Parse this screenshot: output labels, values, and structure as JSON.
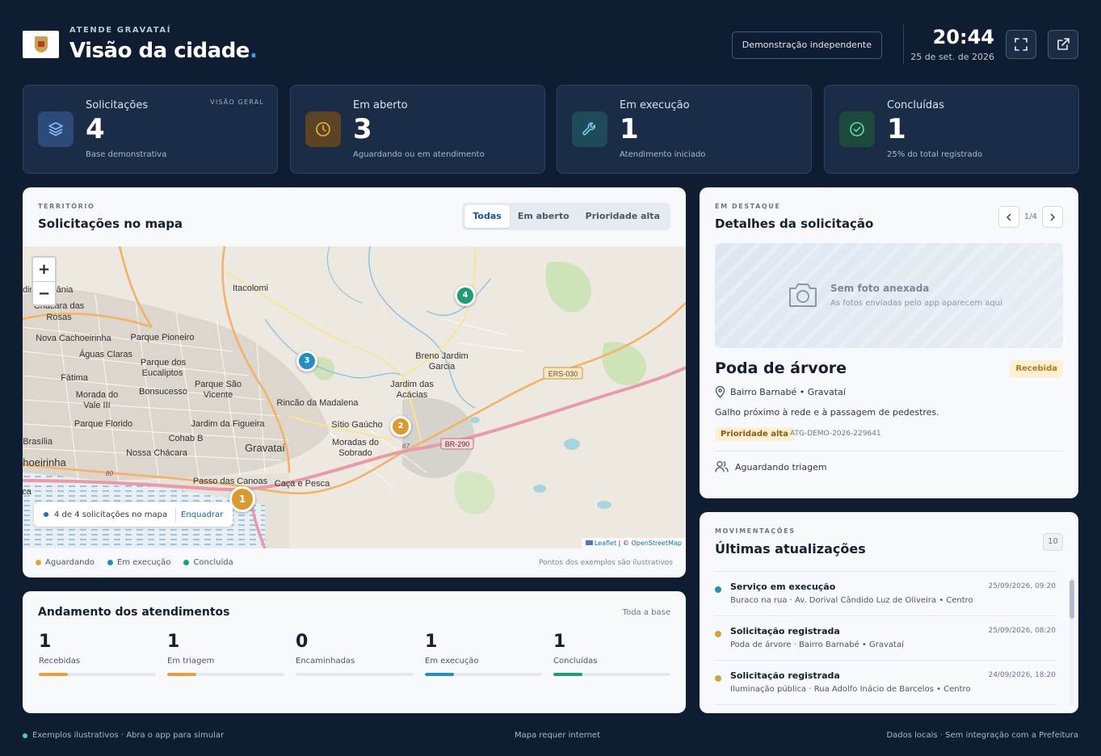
{
  "header": {
    "org": "ATENDE GRAVATAÍ",
    "title": "Visão da cidade",
    "title_dot": ".",
    "demo_button": "Demonstração independente",
    "time": "20:44",
    "date": "25 de set. de 2026"
  },
  "kpis": [
    {
      "label": "Solicitações",
      "value": "4",
      "note": "Base demonstrativa",
      "badge": "VISÃO GERAL",
      "icon": "layers-icon",
      "color": "#6ea8ff"
    },
    {
      "label": "Em aberto",
      "value": "3",
      "note": "Aguardando ou em atendimento",
      "icon": "clock-icon",
      "color": "#e3a33c"
    },
    {
      "label": "Em execução",
      "value": "1",
      "note": "Atendimento iniciado",
      "icon": "wrench-icon",
      "color": "#4fb6d8"
    },
    {
      "label": "Concluídas",
      "value": "1",
      "note": "25% do total registrado",
      "icon": "check-circle-icon",
      "color": "#4fd1a5"
    }
  ],
  "map_panel": {
    "eyebrow": "TERRITÓRIO",
    "title": "Solicitações no mapa",
    "filters": [
      "Todas",
      "Em aberto",
      "Prioridade alta"
    ],
    "active_filter": "Todas",
    "zoom_in": "+",
    "zoom_out": "−",
    "status_text": "4 de 4 solicitações no mapa",
    "fit_link": "Enquadrar",
    "attribution_leaflet": "Leaflet",
    "attribution_sep": "| ©",
    "attribution_osm": "OpenStreetMap",
    "markers": [
      "1",
      "2",
      "3",
      "4"
    ],
    "place_labels": [
      "Itacolomi",
      "Parque Pioneiro",
      "Nova Cachoeirinha",
      "Águas Claras",
      "Parque dos",
      "Eucaliptos",
      "Fátima",
      "Bonsucesso",
      "Parque São",
      "Vicente",
      "Morada do",
      "Vale III",
      "Parque Florido",
      "Jardim da Figueira",
      "Cohab B",
      "Gravataí",
      "Nossa Chácara",
      "Rincão da Madalena",
      "Sítio Gaúcho",
      "Moradas do",
      "Sobrado",
      "Breno Jardim",
      "Garcia",
      "Jardim das",
      "Acácias",
      "Passo das Canoas",
      "Caça e Pesca",
      "Chácara das",
      "Rosas",
      "rdim",
      "ânia",
      "e Brasília",
      "hoeirinha",
      "ca"
    ],
    "road_labels": [
      "ERS-030",
      "BR-290",
      "67",
      "80"
    ],
    "legend": [
      {
        "label": "Aguardando",
        "color": "#e3a33c"
      },
      {
        "label": "Em execução",
        "color": "#1f8fc4"
      },
      {
        "label": "Concluída",
        "color": "#1f9e74"
      }
    ],
    "note": "Pontos dos exemplos são ilustrativos"
  },
  "progress": {
    "title": "Andamento dos atendimentos",
    "scope": "Toda a base",
    "items": [
      {
        "value": "1",
        "label": "Recebidas",
        "fraction": 0.25,
        "color": "#e3a33c"
      },
      {
        "value": "1",
        "label": "Em triagem",
        "fraction": 0.25,
        "color": "#e3a33c"
      },
      {
        "value": "0",
        "label": "Encaminhadas",
        "fraction": 0,
        "color": "#8a97a8"
      },
      {
        "value": "1",
        "label": "Em execução",
        "fraction": 0.25,
        "color": "#1f8fc4"
      },
      {
        "value": "1",
        "label": "Concluídas",
        "fraction": 0.25,
        "color": "#1f9e74"
      }
    ]
  },
  "detail": {
    "eyebrow": "EM DESTAQUE",
    "title": "Detalhes da solicitação",
    "pager": "1/4",
    "photo_title": "Sem foto anexada",
    "photo_sub": "As fotos enviadas pelo app aparecem aqui",
    "request_title": "Poda de árvore",
    "status": "Recebida",
    "location": "Bairro Barnabé • Gravataí",
    "description": "Galho próximo à rede e à passagem de pedestres.",
    "priority": "Prioridade alta",
    "code": "ATG-DEMO-2026-229641",
    "assignee": "Aguardando triagem"
  },
  "updates": {
    "eyebrow": "MOVIMENTAÇÕES",
    "title": "Últimas atualizações",
    "count": "10",
    "items": [
      {
        "title": "Serviço em execução",
        "time": "25/09/2026, 09:20",
        "sub": "Buraco na rua · Av. Dorival Cândido Luz de Oliveira • Centro",
        "color": "#1f8fc4"
      },
      {
        "title": "Solicitação registrada",
        "time": "25/09/2026, 08:20",
        "sub": "Poda de árvore · Bairro Barnabé • Gravataí",
        "color": "#d4a03c"
      },
      {
        "title": "Solicitação registrada",
        "time": "24/09/2026, 18:20",
        "sub": "Iluminação pública · Rua Adolfo Inácio de Barcelos • Centro",
        "color": "#d4a03c"
      }
    ]
  },
  "footer": {
    "left": "Exemplos ilustrativos · Abra o app para simular",
    "middle": "Mapa requer internet",
    "right": "Dados locais · Sem integração com a Prefeitura"
  }
}
